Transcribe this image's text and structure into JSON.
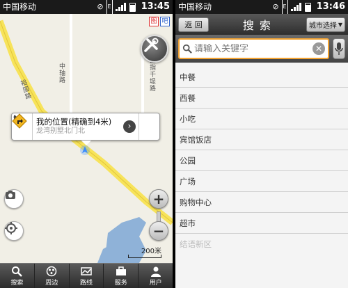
{
  "left": {
    "status": {
      "carrier": "中国移动",
      "time": "13:45"
    },
    "map": {
      "road_label_1": "中轴路",
      "road_label_2": "裕国路",
      "road_label_3": "田指千堤路",
      "location_title": "我的位置(精确到4米)",
      "location_address": "龙湾别墅北门北",
      "scale": "200米"
    },
    "nav": [
      {
        "label": "搜索",
        "icon": "search-icon"
      },
      {
        "label": "周边",
        "icon": "nearby-icon"
      },
      {
        "label": "路线",
        "icon": "route-icon"
      },
      {
        "label": "服务",
        "icon": "briefcase-icon"
      },
      {
        "label": "用户",
        "icon": "user-icon"
      }
    ]
  },
  "right": {
    "status": {
      "carrier": "中国移动",
      "time": "13:46"
    },
    "back_label": "返 回",
    "title": "搜索",
    "city_label": "城市选择",
    "search_placeholder": "请输入关键字",
    "categories": [
      "中餐",
      "西餐",
      "小吃",
      "宾馆饭店",
      "公园",
      "广场",
      "购物中心",
      "超市"
    ],
    "cut_item": "结语新区"
  },
  "colors": {
    "accent": "#f2a230",
    "road": "#f7e35a"
  }
}
